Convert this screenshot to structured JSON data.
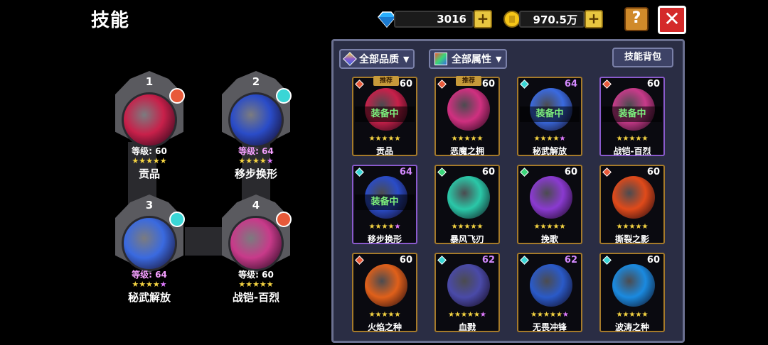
{
  "title": "技能",
  "currency": {
    "gems": "3016",
    "gold": "970.5万"
  },
  "colors": {
    "accent_gold": "#f5d442",
    "equip_green": "#7df07d",
    "panel": "#2a2d44",
    "close_red": "#d42a2a",
    "purple_star": "#e07aff"
  },
  "buttons": {
    "help": "?",
    "close": "✕",
    "plus": "+"
  },
  "filters": {
    "quality": "全部品质",
    "attribute": "全部属性",
    "bag": "技能背包",
    "caret": "▼"
  },
  "slots": [
    {
      "num": "1",
      "level_text": "等级: 60",
      "name": "贡品",
      "stars": "★★★★★",
      "pink": "",
      "elem": "#e85a3a",
      "orb": "#c8204a",
      "lv_color": "#ffffff"
    },
    {
      "num": "2",
      "level_text": "等级: 64",
      "name": "移步换形",
      "stars": "★★★★",
      "pink": "★",
      "elem": "#3ad6d6",
      "orb": "#2a4cc8",
      "lv_color": "#f5a0ff"
    },
    {
      "num": "3",
      "level_text": "等级: 64",
      "name": "秘武解放",
      "stars": "★★★★",
      "pink": "★",
      "elem": "#3ad6d6",
      "orb": "#3a6ae0",
      "lv_color": "#f5a0ff"
    },
    {
      "num": "4",
      "level_text": "等级: 60",
      "name": "战铠-百烈",
      "stars": "★★★★★",
      "pink": "",
      "elem": "#e85a3a",
      "orb": "#c83a8a",
      "lv_color": "#ffffff"
    }
  ],
  "cards": [
    {
      "name": "贡品",
      "level": "60",
      "equipped": "装备中",
      "rec": "推荐",
      "stars": "★★★★★",
      "pink": "",
      "gem": "#e85a3a",
      "orb": "#c8204a",
      "purple": false
    },
    {
      "name": "恶魔之拥",
      "level": "60",
      "equipped": "",
      "rec": "推荐",
      "stars": "★★★★★",
      "pink": "",
      "gem": "#e85a3a",
      "orb": "#d03080",
      "purple": false
    },
    {
      "name": "秘武解放",
      "level": "64",
      "equipped": "装备中",
      "rec": "",
      "stars": "★★★★",
      "pink": "★",
      "gem": "#3ad6d6",
      "orb": "#3a6ae0",
      "purple": false
    },
    {
      "name": "战铠-百烈",
      "level": "60",
      "equipped": "装备中",
      "rec": "",
      "stars": "★★★★★",
      "pink": "",
      "gem": "#e85a3a",
      "orb": "#c83a8a",
      "purple": true
    },
    {
      "name": "移步换形",
      "level": "64",
      "equipped": "装备中",
      "rec": "",
      "stars": "★★★★",
      "pink": "★",
      "gem": "#3ad6d6",
      "orb": "#2a4cc8",
      "purple": true
    },
    {
      "name": "暴风飞刃",
      "level": "60",
      "equipped": "",
      "rec": "",
      "stars": "★★★★★",
      "pink": "",
      "gem": "#3ad67a",
      "orb": "#2ac8a8",
      "purple": false
    },
    {
      "name": "挽歌",
      "level": "60",
      "equipped": "",
      "rec": "",
      "stars": "★★★★★",
      "pink": "",
      "gem": "#3ad67a",
      "orb": "#8a3ad0",
      "purple": false
    },
    {
      "name": "撕裂之影",
      "level": "60",
      "equipped": "",
      "rec": "",
      "stars": "★★★★★",
      "pink": "",
      "gem": "#e85a3a",
      "orb": "#e04a1a",
      "purple": false
    },
    {
      "name": "火焰之种",
      "level": "60",
      "equipped": "",
      "rec": "",
      "stars": "★★★★★",
      "pink": "",
      "gem": "#e85a3a",
      "orb": "#e0601a",
      "purple": false
    },
    {
      "name": "血戮",
      "level": "62",
      "equipped": "",
      "rec": "",
      "stars": "★★★★★",
      "pink": "★",
      "gem": "#3ad6d6",
      "orb": "#4a4aa8",
      "purple": false
    },
    {
      "name": "无畏冲锋",
      "level": "62",
      "equipped": "",
      "rec": "",
      "stars": "★★★★★",
      "pink": "★",
      "gem": "#3ad6d6",
      "orb": "#2a5ac8",
      "purple": false
    },
    {
      "name": "波涛之种",
      "level": "60",
      "equipped": "",
      "rec": "",
      "stars": "★★★★★",
      "pink": "",
      "gem": "#3ad6d6",
      "orb": "#1a8ae0",
      "purple": false
    }
  ]
}
